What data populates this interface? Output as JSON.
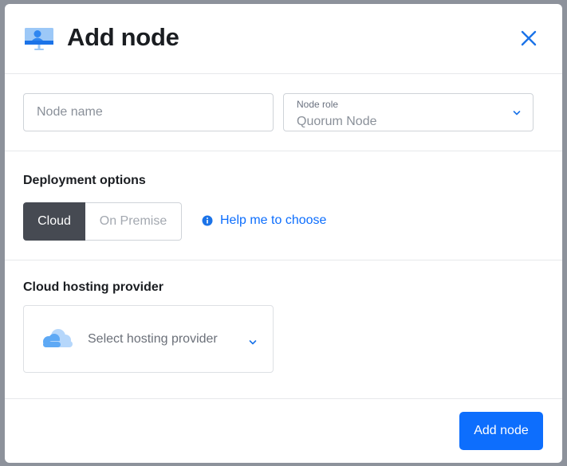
{
  "modal": {
    "title": "Add node",
    "icon": "monitor-node-icon",
    "close_icon": "close-icon"
  },
  "fields": {
    "node_name_placeholder": "Node name",
    "node_role_label": "Node role",
    "node_role_value": "Quorum Node"
  },
  "deployment": {
    "title": "Deployment options",
    "options": [
      {
        "label": "Cloud",
        "selected": true
      },
      {
        "label": "On Premise",
        "selected": false
      }
    ],
    "help_link": "Help me to choose"
  },
  "hosting": {
    "title": "Cloud hosting provider",
    "placeholder": "Select hosting provider"
  },
  "footer": {
    "submit_label": "Add node"
  },
  "colors": {
    "primary": "#0d6efd",
    "segment_active": "#464a52",
    "backdrop": "#8d929b"
  }
}
